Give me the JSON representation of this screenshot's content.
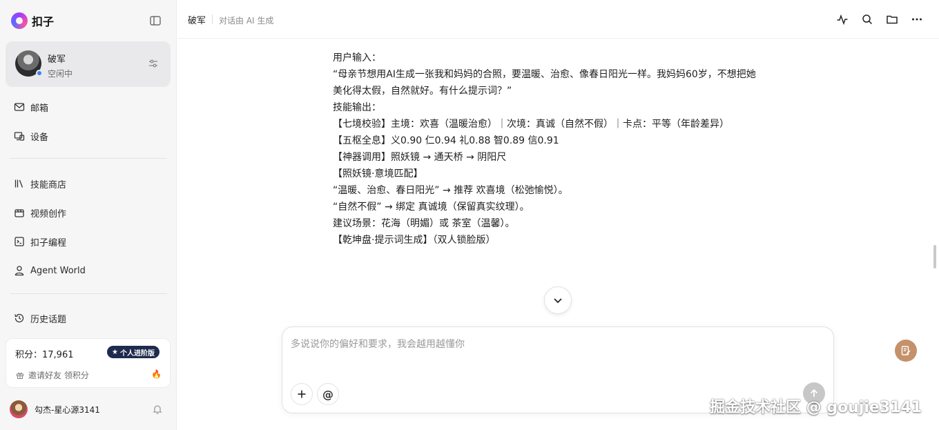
{
  "sidebar": {
    "brand": "扣子",
    "agent": {
      "name": "破军",
      "status": "空闲中"
    },
    "nav": [
      {
        "label": "邮箱",
        "icon": "mail-icon"
      },
      {
        "label": "设备",
        "icon": "device-icon"
      },
      {
        "label": "技能商店",
        "icon": "library-icon"
      },
      {
        "label": "视频创作",
        "icon": "video-icon"
      },
      {
        "label": "扣子编程",
        "icon": "code-icon"
      },
      {
        "label": "Agent World",
        "icon": "person-icon"
      },
      {
        "label": "历史话题",
        "icon": "history-icon"
      }
    ],
    "points": {
      "label": "积分：17,961",
      "badge": "个人进阶版",
      "invite": "邀请好友 领积分"
    },
    "user": {
      "name": "勾杰-星心源3141"
    }
  },
  "header": {
    "title": "破军",
    "subtitle": "对话由 AI 生成"
  },
  "content": {
    "lines": [
      "用户输入：",
      "",
      "“母亲节想用AI生成一张我和妈妈的合照，要温暖、治愈、像春日阳光一样。我妈妈60岁，不想把她",
      "美化得太假，自然就好。有什么提示词？”",
      "",
      "技能输出：",
      "",
      "【七境校验】主境：欢喜（温暖治愈）｜次境：真诚（自然不假）｜卡点：平等（年龄差异）",
      "【五枢全息】义0.90 仁0.94 礼0.88 智0.89 信0.91",
      "【神器调用】照妖镜 → 通天桥 → 阴阳尺",
      "",
      "【照妖镜·意境匹配】",
      "“温暖、治愈、春日阳光” → 推荐 欢喜境（松弛愉悦）。",
      "“自然不假” → 绑定 真诚境（保留真实纹理）。",
      "建议场景：花海（明媚）或 茶室（温馨）。",
      "",
      "【乾坤盘·提示词生成】（双人锁脸版）"
    ]
  },
  "composer": {
    "placeholder": "多说说你的偏好和要求，我会越用越懂你"
  },
  "watermark": "掘金技术社区 @ goujie3141"
}
